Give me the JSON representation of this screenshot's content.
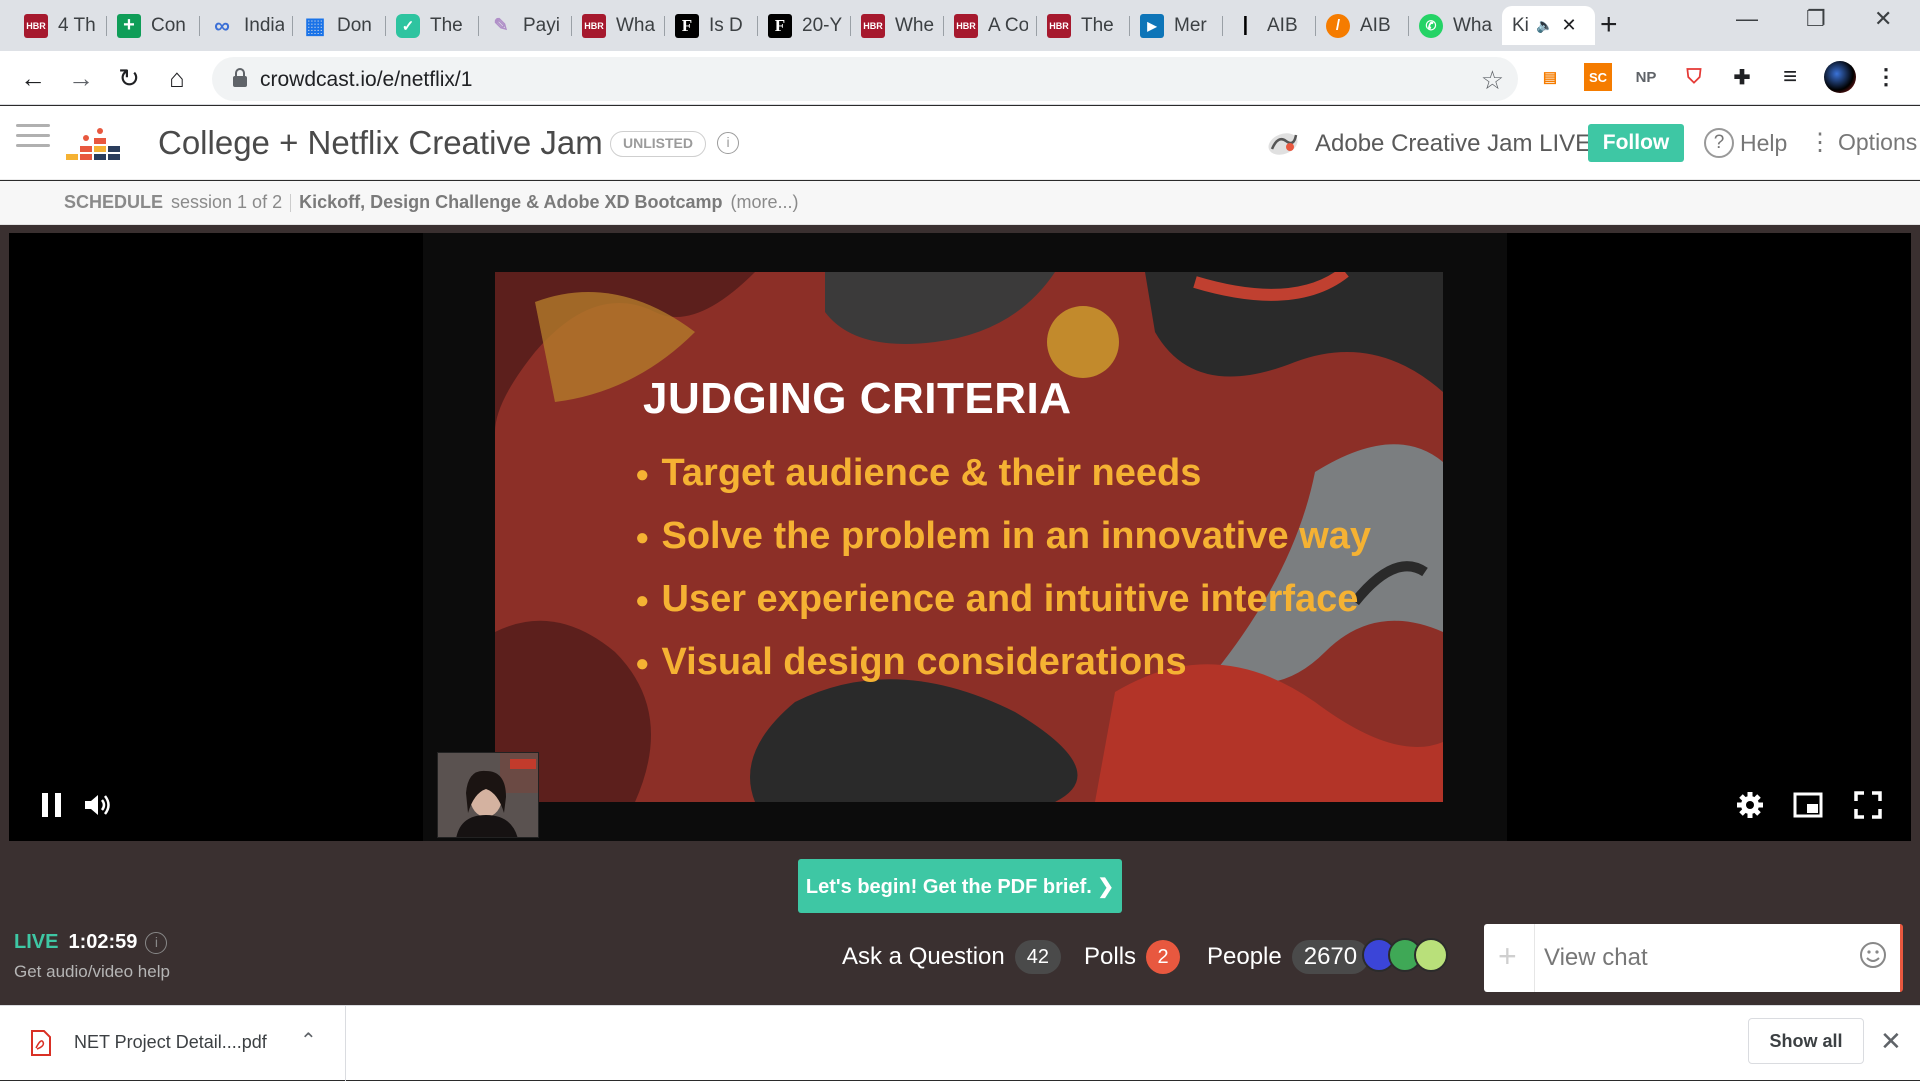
{
  "browser": {
    "tabs": [
      {
        "title": "4 Th",
        "icon": "hbr-icon",
        "color": "#a6192e",
        "glyph": "HBR"
      },
      {
        "title": "Con",
        "icon": "sheets-plus-icon",
        "color": "#0f9d58",
        "glyph": "+"
      },
      {
        "title": "India",
        "icon": "infinity-icon",
        "color": "#ffffff",
        "glyph": "∞"
      },
      {
        "title": "Don",
        "icon": "grid-icon",
        "color": "#1a73e8",
        "glyph": "▦"
      },
      {
        "title": "The",
        "icon": "shield-check-icon",
        "color": "#2ec4a0",
        "glyph": "✓"
      },
      {
        "title": "Payi",
        "icon": "pay-icon",
        "color": "#e8e0f0",
        "glyph": "✎"
      },
      {
        "title": "Wha",
        "icon": "hbr-icon",
        "color": "#a6192e",
        "glyph": "HBR"
      },
      {
        "title": "Is D",
        "icon": "forbes-icon",
        "color": "#000000",
        "glyph": "F"
      },
      {
        "title": "20-Y",
        "icon": "forbes-icon",
        "color": "#000000",
        "glyph": "F"
      },
      {
        "title": "Whe",
        "icon": "hbr-icon",
        "color": "#a6192e",
        "glyph": "HBR"
      },
      {
        "title": "A Co",
        "icon": "hbr-icon",
        "color": "#a6192e",
        "glyph": "HBR"
      },
      {
        "title": "The",
        "icon": "hbr-icon",
        "color": "#a6192e",
        "glyph": "HBR"
      },
      {
        "title": "Mer",
        "icon": "play-icon",
        "color": "#0e75b8",
        "glyph": "▶"
      },
      {
        "title": "AIB",
        "icon": "aib-icon",
        "color": "#ffffff",
        "glyph": "|"
      },
      {
        "title": "AIB",
        "icon": "aib-orange-icon",
        "color": "#f57c00",
        "glyph": "/"
      },
      {
        "title": "Wha",
        "icon": "whatsapp-icon",
        "color": "#25d366",
        "glyph": "✆"
      }
    ],
    "active_tab": {
      "title": "Ki",
      "speaker": "🔈",
      "close": "✕"
    },
    "new_tab": "+",
    "window_controls": {
      "minimize": "—",
      "restore": "❐",
      "close": "✕"
    },
    "url": "crowdcast.io/e/netflix/1",
    "extensions": [
      {
        "name": "layout-ext-icon",
        "text": "▤",
        "color": "#f57c00"
      },
      {
        "name": "sc-ext-icon",
        "text": "SC",
        "color": "#f57c00"
      },
      {
        "name": "np-ext-icon",
        "text": "NP",
        "color": "#5f6368"
      },
      {
        "name": "shield-ext-icon",
        "text": "⛉",
        "color": "#e53935"
      },
      {
        "name": "puzzle-icon",
        "text": "✚",
        "color": "#202124"
      },
      {
        "name": "media-queue-icon",
        "text": "≡",
        "color": "#202124"
      }
    ]
  },
  "header": {
    "event_title": "College + Netflix Creative Jam",
    "badge": "UNLISTED",
    "info": "i",
    "host_name": "Adobe Creative Jam LIVE",
    "follow_label": "Follow",
    "help_label": "Help",
    "options_label": "Options"
  },
  "schedule": {
    "label": "SCHEDULE",
    "session": "session 1 of 2",
    "title": "Kickoff, Design Challenge & Adobe XD Bootcamp",
    "more": "(more...)"
  },
  "slide": {
    "heading": "JUDGING CRITERIA",
    "bullets": [
      "Target audience & their needs",
      "Solve the problem in an innovative way",
      "User experience and intuitive interface",
      "Visual design considerations"
    ]
  },
  "cta_label": "Let's begin! Get the PDF brief. ❯",
  "live": {
    "badge": "LIVE",
    "time": "1:02:59",
    "help": "Get audio/video help"
  },
  "stats": {
    "questions_label": "Ask a Question",
    "questions_count": "42",
    "polls_label": "Polls",
    "polls_count": "2",
    "people_label": "People",
    "people_count": "2670"
  },
  "chat": {
    "placeholder": "View chat"
  },
  "downloads": {
    "file_name": "NET Project Detail....pdf",
    "show_all": "Show all",
    "close": "✕"
  },
  "colors": {
    "accent": "#3ec7a4",
    "badge_red": "#e8583f",
    "slide_bg": "#8c2f27",
    "slide_text": "#f5b233"
  }
}
